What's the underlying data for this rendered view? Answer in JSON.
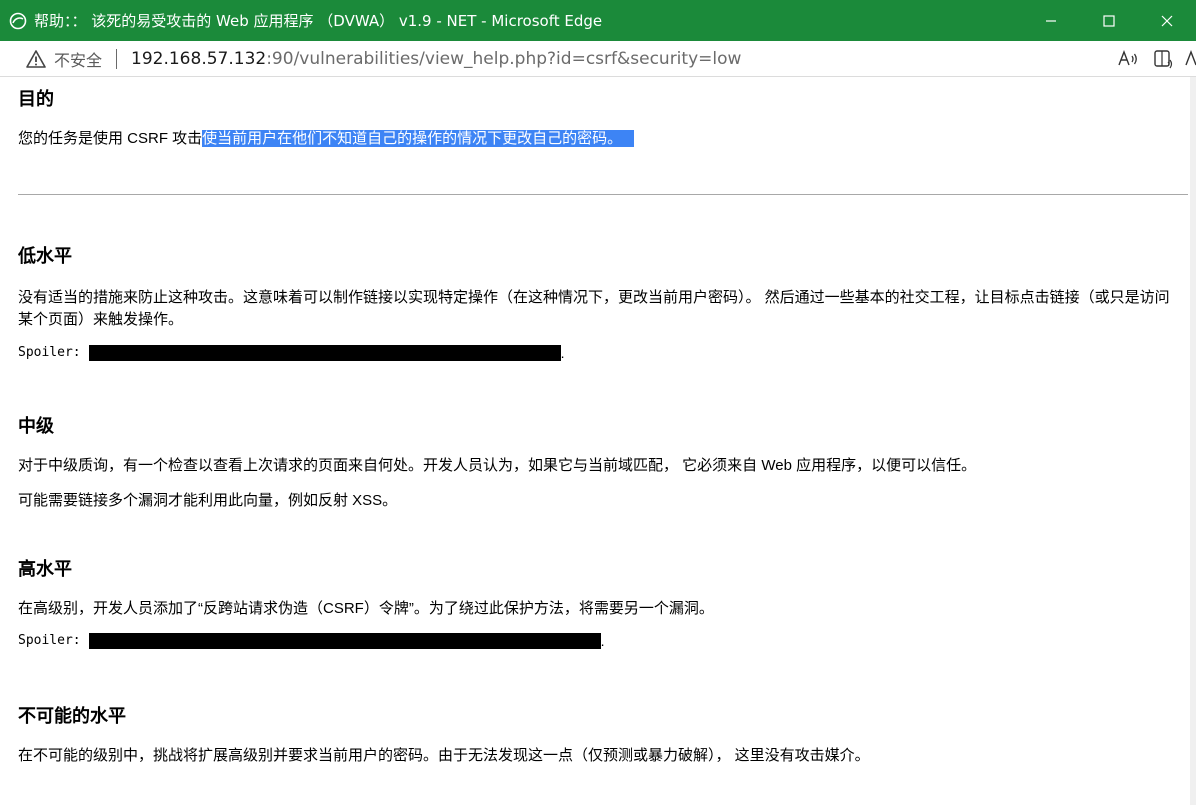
{
  "window": {
    "title": "帮助：： 该死的易受攻击的 Web 应用程序 （DVWA） v1.9 - NET - Microsoft Edge",
    "minimize_icon": "minimize-icon",
    "maximize_icon": "maximize-icon",
    "close_icon": "close-icon",
    "accent_color": "#1b8a3a"
  },
  "addressbar": {
    "security_warning": "不安全",
    "url_host": "192.168.57.132",
    "url_rest": ":90/vulnerabilities/view_help.php?id=csrf&security=low"
  },
  "content": {
    "objective": {
      "heading": "目的",
      "text_plain": "您的任务是使用 CSRF 攻击",
      "text_selected": "使当前用户在他们不知道自己的操作的情况下更改自己的密码。"
    },
    "low": {
      "heading": "低水平",
      "text": "没有适当的措施来防止这种攻击。这意味着可以制作链接以实现特定操作（在这种情况下，更改当前用户密码）。 然后通过一些基本的社交工程，让目标点击链接（或只是访问某个页面）来触发操作。",
      "spoiler_label": "Spoiler:",
      "spoiler_end": "."
    },
    "medium": {
      "heading": "中级",
      "text1": "对于中级质询，有一个检查以查看上次请求的页面来自何处。开发人员认为，如果它与当前域匹配， 它必须来自 Web 应用程序，以便可以信任。",
      "text2": "可能需要链接多个漏洞才能利用此向量，例如反射 XSS。"
    },
    "high": {
      "heading": "高水平",
      "text": "在高级别，开发人员添加了“反跨站请求伪造（CSRF）令牌”。为了绕过此保护方法，将需要另一个漏洞。",
      "spoiler_label": "Spoiler:",
      "spoiler_end": "."
    },
    "impossible": {
      "heading": "不可能的水平",
      "text": "在不可能的级别中，挑战将扩展高级别并要求当前用户的密码。由于无法发现这一点（仅预测或暴力破解）， 这里没有攻击媒介。"
    }
  }
}
